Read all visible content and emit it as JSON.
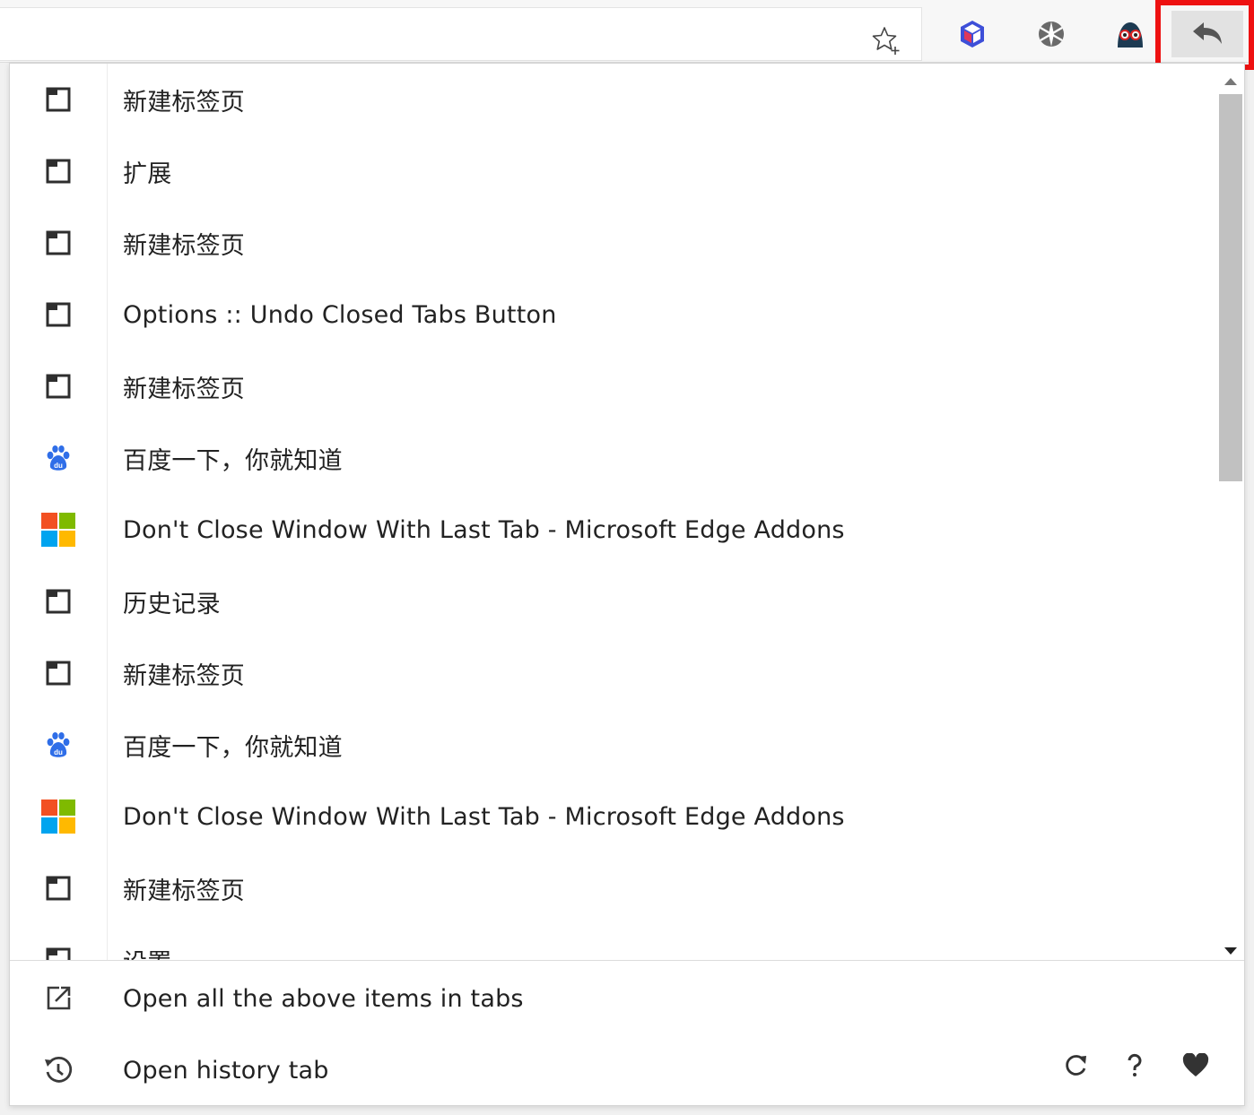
{
  "toolbar": {
    "icons": [
      "star-add-icon",
      "cube-extension-icon",
      "puzzle-ball-icon",
      "spy-glasses-icon",
      "undo-arrow-icon"
    ]
  },
  "popup": {
    "items": [
      {
        "icon": "page-icon",
        "label": "新建标签页"
      },
      {
        "icon": "page-icon",
        "label": "扩展"
      },
      {
        "icon": "page-icon",
        "label": "新建标签页"
      },
      {
        "icon": "page-icon",
        "label": "Options :: Undo Closed Tabs Button"
      },
      {
        "icon": "page-icon",
        "label": "新建标签页"
      },
      {
        "icon": "baidu-icon",
        "label": "百度一下，你就知道"
      },
      {
        "icon": "microsoft-icon",
        "label": "Don't Close Window With Last Tab - Microsoft Edge Addons"
      },
      {
        "icon": "page-icon",
        "label": "历史记录"
      },
      {
        "icon": "page-icon",
        "label": "新建标签页"
      },
      {
        "icon": "baidu-icon",
        "label": "百度一下，你就知道"
      },
      {
        "icon": "microsoft-icon",
        "label": "Don't Close Window With Last Tab - Microsoft Edge Addons"
      },
      {
        "icon": "page-icon",
        "label": "新建标签页"
      },
      {
        "icon": "page-icon",
        "label": "设置"
      }
    ],
    "footer": {
      "open_all_label": "Open all the above items in tabs",
      "open_history_label": "Open history tab"
    }
  },
  "colors": {
    "highlight": "#ee1111",
    "ms_red": "#f25022",
    "ms_green": "#7fba00",
    "ms_blue": "#00a4ef",
    "ms_yellow": "#ffb900",
    "baidu_blue": "#2f6ee8"
  }
}
